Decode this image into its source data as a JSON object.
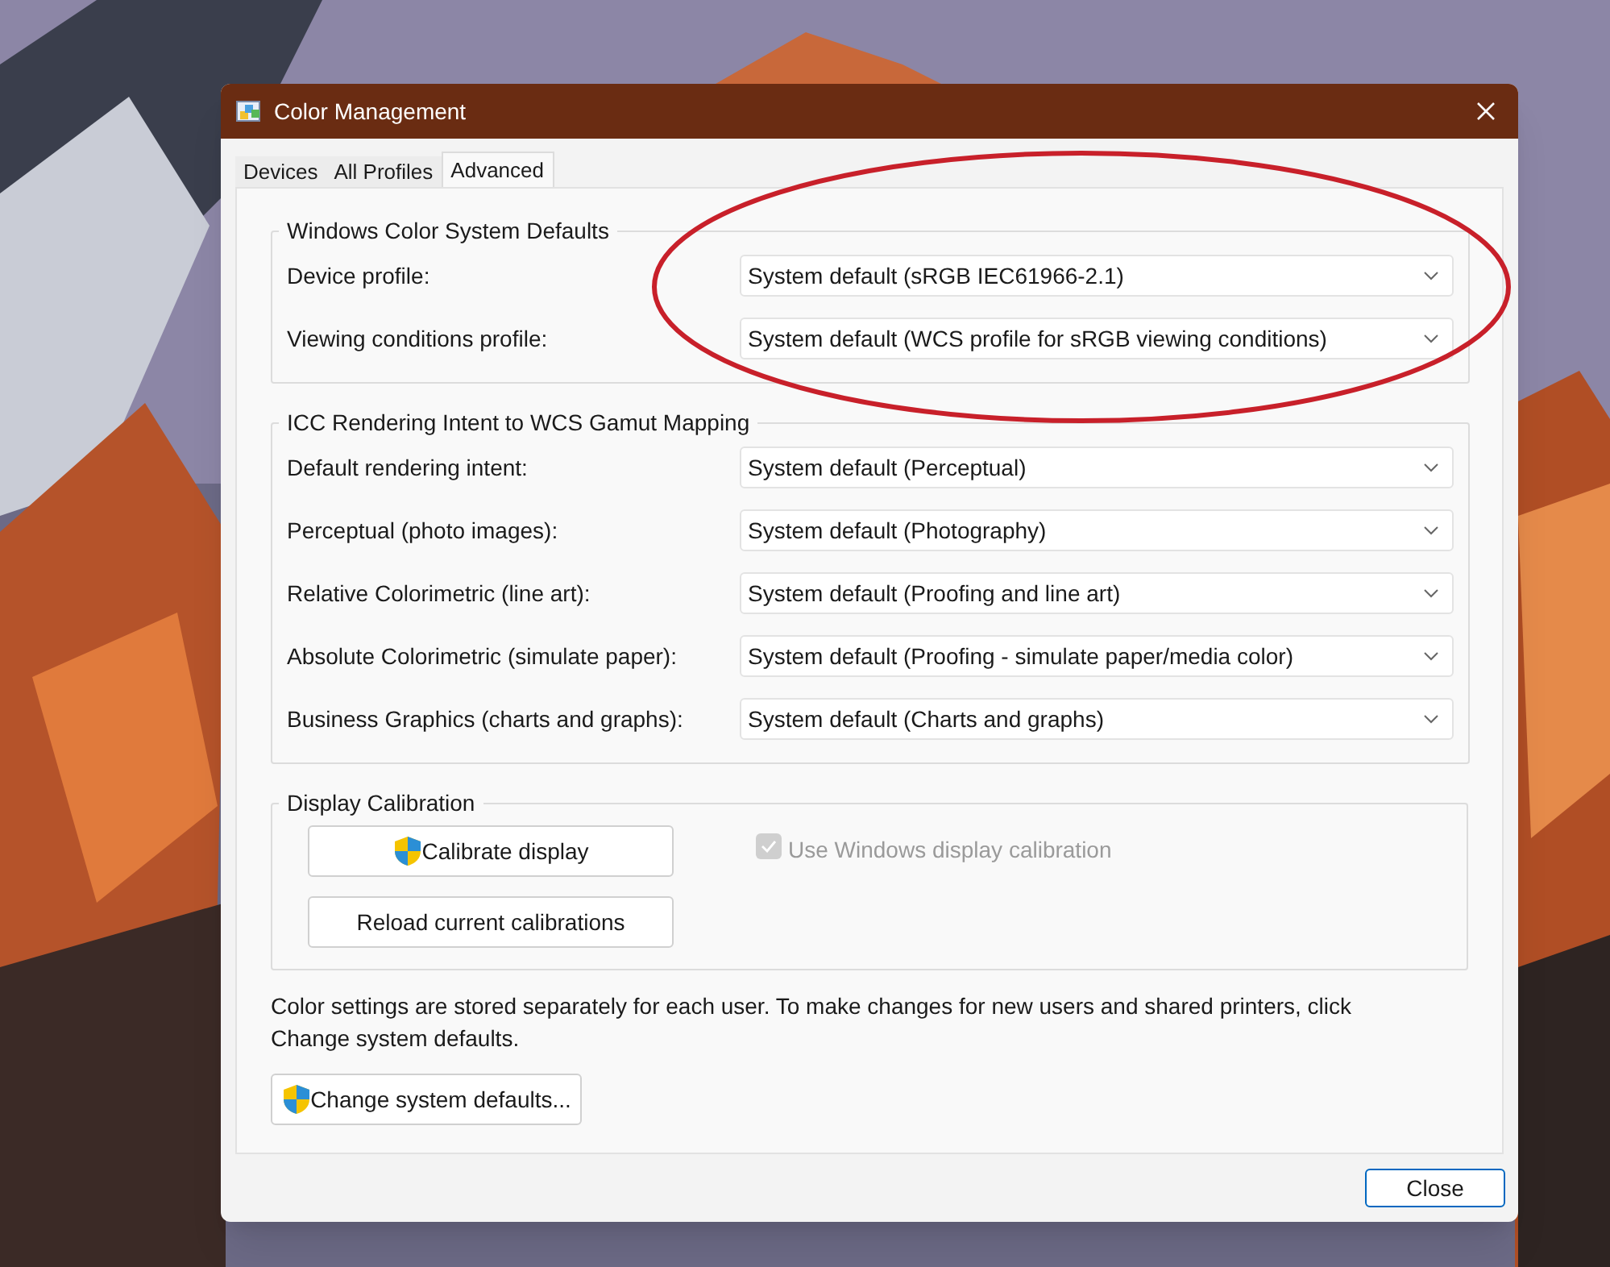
{
  "window": {
    "title": "Color Management"
  },
  "tabs": [
    {
      "label": "Devices",
      "selected": false
    },
    {
      "label": "All Profiles",
      "selected": false
    },
    {
      "label": "Advanced",
      "selected": true
    }
  ],
  "groups": [
    {
      "title": "Windows Color System Defaults",
      "rows": [
        {
          "label": "Device profile:",
          "value": "System default (sRGB IEC61966-2.1)"
        },
        {
          "label": "Viewing conditions profile:",
          "value": "System default (WCS profile for sRGB viewing conditions)"
        }
      ]
    },
    {
      "title": "ICC Rendering Intent to WCS Gamut Mapping",
      "rows": [
        {
          "label": "Default rendering intent:",
          "value": "System default (Perceptual)"
        },
        {
          "label": "Perceptual (photo images):",
          "value": "System default (Photography)"
        },
        {
          "label": "Relative Colorimetric (line art):",
          "value": "System default (Proofing and line art)"
        },
        {
          "label": "Absolute Colorimetric (simulate paper):",
          "value": "System default (Proofing - simulate paper/media color)"
        },
        {
          "label": "Business Graphics (charts and graphs):",
          "value": "System default (Charts and graphs)"
        }
      ]
    }
  ],
  "calibration": {
    "title": "Display Calibration",
    "buttons": [
      {
        "label": "Calibrate display",
        "shield": true
      },
      {
        "label": "Reload current calibrations",
        "shield": false
      }
    ],
    "checkbox": {
      "label": "Use Windows display calibration",
      "checked": true,
      "disabled": true
    }
  },
  "note": "Color settings are stored separately for each user. To make changes for new users and shared printers, click Change system defaults.",
  "change_button": {
    "label": "Change system defaults...",
    "shield": true
  },
  "close_button": {
    "label": "Close"
  }
}
